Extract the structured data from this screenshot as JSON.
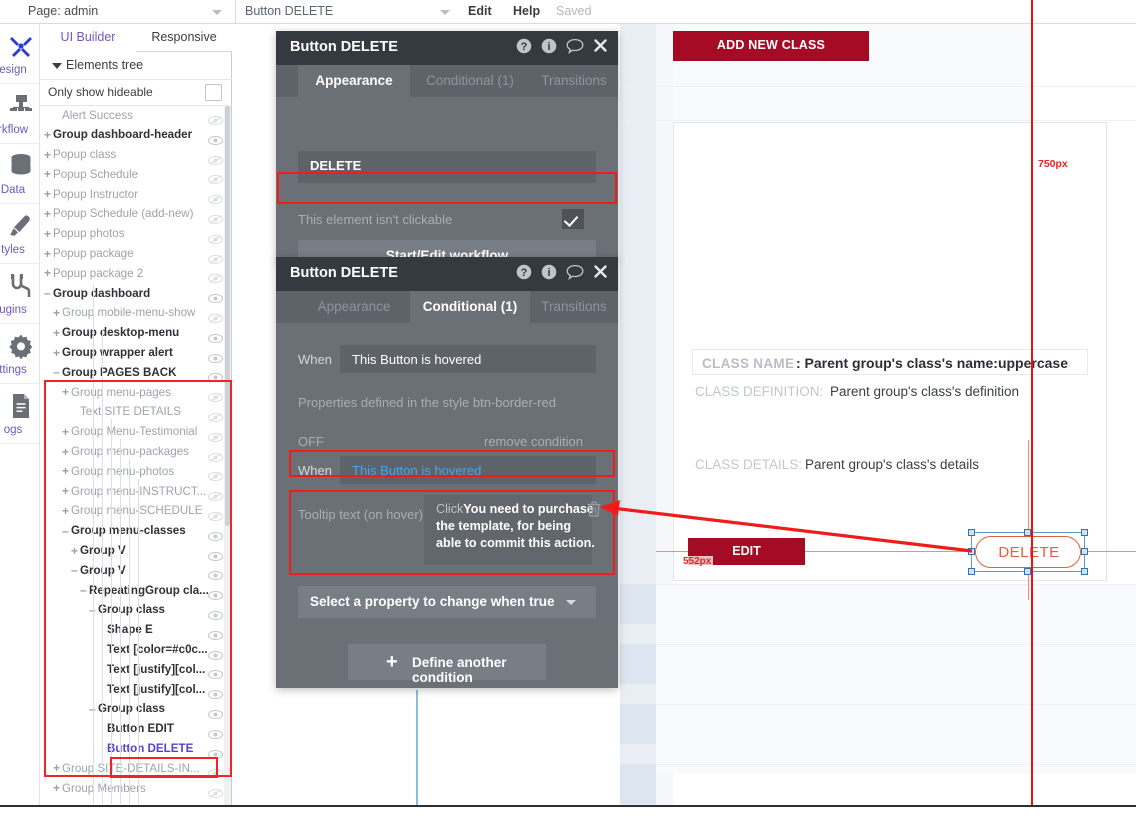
{
  "topbar": {
    "page_label": "Page: admin",
    "element_label": "Button DELETE",
    "edit": "Edit",
    "help": "Help",
    "saved": "Saved"
  },
  "rail": {
    "items": [
      {
        "label": "esign",
        "full": "Design",
        "icon": "design-icon"
      },
      {
        "label": "rkflow",
        "full": "Workflow",
        "icon": "workflow-icon"
      },
      {
        "label": "Data",
        "full": "Data",
        "icon": "data-icon"
      },
      {
        "label": "tyles",
        "full": "Styles",
        "icon": "styles-icon"
      },
      {
        "label": "ugins",
        "full": "Plugins",
        "icon": "plugins-icon"
      },
      {
        "label": "ttings",
        "full": "Settings",
        "icon": "settings-icon"
      },
      {
        "label": "ogs",
        "full": "Logs",
        "icon": "logs-icon"
      }
    ]
  },
  "panel": {
    "tab_ui_builder": "UI Builder",
    "tab_responsive": "Responsive",
    "tree_header": "Elements tree",
    "only_show_hideable": "Only show hideable"
  },
  "tree": {
    "items": [
      {
        "label": "Alert Success",
        "indent": 1,
        "toggle": "",
        "state": "gray",
        "eye": "hidden"
      },
      {
        "label": "Group dashboard-header",
        "indent": 0,
        "toggle": "+",
        "state": "dark",
        "eye": "visible"
      },
      {
        "label": "Popup class",
        "indent": 0,
        "toggle": "+",
        "state": "gray",
        "eye": "hidden"
      },
      {
        "label": "Popup Schedule",
        "indent": 0,
        "toggle": "+",
        "state": "gray",
        "eye": "hidden"
      },
      {
        "label": "Popup Instructor",
        "indent": 0,
        "toggle": "+",
        "state": "gray",
        "eye": "hidden"
      },
      {
        "label": "Popup Schedule (add-new)",
        "indent": 0,
        "toggle": "+",
        "state": "gray",
        "eye": "hidden"
      },
      {
        "label": "Popup photos",
        "indent": 0,
        "toggle": "+",
        "state": "gray",
        "eye": "hidden"
      },
      {
        "label": "Popup package",
        "indent": 0,
        "toggle": "+",
        "state": "gray",
        "eye": "hidden"
      },
      {
        "label": "Popup package 2",
        "indent": 0,
        "toggle": "+",
        "state": "gray",
        "eye": "hidden"
      },
      {
        "label": "Group dashboard",
        "indent": 0,
        "toggle": "–",
        "state": "dark",
        "eye": "visible"
      },
      {
        "label": "Group mobile-menu-show",
        "indent": 1,
        "toggle": "+",
        "state": "gray",
        "eye": "hidden"
      },
      {
        "label": "Group desktop-menu",
        "indent": 1,
        "toggle": "+",
        "state": "dark",
        "eye": "visible"
      },
      {
        "label": "Group wrapper alert",
        "indent": 1,
        "toggle": "+",
        "state": "dark",
        "eye": "visible"
      },
      {
        "label": "Group PAGES BACK",
        "indent": 1,
        "toggle": "–",
        "state": "dark",
        "eye": "visible"
      },
      {
        "label": "Group menu-pages",
        "indent": 2,
        "toggle": "+",
        "state": "gray",
        "eye": "hidden"
      },
      {
        "label": "Text SITE DETAILS",
        "indent": 3,
        "toggle": "",
        "state": "gray",
        "eye": "hidden"
      },
      {
        "label": "Group Menu-Testimonial",
        "indent": 2,
        "toggle": "+",
        "state": "gray",
        "eye": "hidden"
      },
      {
        "label": "Group menu-packages",
        "indent": 2,
        "toggle": "+",
        "state": "gray",
        "eye": "hidden"
      },
      {
        "label": "Group menu-photos",
        "indent": 2,
        "toggle": "+",
        "state": "gray",
        "eye": "hidden"
      },
      {
        "label": "Group menu-INSTRUCT...",
        "indent": 2,
        "toggle": "+",
        "state": "gray",
        "eye": "hidden"
      },
      {
        "label": "Group menu-SCHEDULE",
        "indent": 2,
        "toggle": "+",
        "state": "gray",
        "eye": "hidden"
      },
      {
        "label": "Group menu-classes",
        "indent": 2,
        "toggle": "–",
        "state": "dark",
        "eye": "visible"
      },
      {
        "label": "Group V",
        "indent": 3,
        "toggle": "+",
        "state": "dark",
        "eye": "visible"
      },
      {
        "label": "Group V",
        "indent": 3,
        "toggle": "–",
        "state": "dark",
        "eye": "visible"
      },
      {
        "label": "RepeatingGroup cla...",
        "indent": 4,
        "toggle": "–",
        "state": "dark",
        "eye": "visible"
      },
      {
        "label": "Group class",
        "indent": 5,
        "toggle": "–",
        "state": "dark",
        "eye": "visible"
      },
      {
        "label": "Shape E",
        "indent": 6,
        "toggle": "",
        "state": "dark",
        "eye": "visible"
      },
      {
        "label": "Text [color=#c0c...",
        "indent": 6,
        "toggle": "",
        "state": "dark",
        "eye": "visible"
      },
      {
        "label": "Text [justify][col...",
        "indent": 6,
        "toggle": "",
        "state": "dark",
        "eye": "visible"
      },
      {
        "label": "Text [justify][col...",
        "indent": 6,
        "toggle": "",
        "state": "dark",
        "eye": "visible"
      },
      {
        "label": "Group class",
        "indent": 5,
        "toggle": "–",
        "state": "dark",
        "eye": "visible"
      },
      {
        "label": "Button EDIT",
        "indent": 6,
        "toggle": "",
        "state": "dark",
        "eye": "visible"
      },
      {
        "label": "Button DELETE",
        "indent": 6,
        "toggle": "",
        "state": "selected",
        "eye": "visible"
      },
      {
        "label": "Group SITE-DETAILS-IN...",
        "indent": 1,
        "toggle": "+",
        "state": "gray",
        "eye": "hidden"
      },
      {
        "label": "Group Members",
        "indent": 1,
        "toggle": "+",
        "state": "gray",
        "eye": "hidden"
      }
    ]
  },
  "appearance_panel": {
    "title": "Button DELETE",
    "tabs": [
      {
        "label": "Appearance",
        "active": true
      },
      {
        "label": "Conditional (1)",
        "active": false
      },
      {
        "label": "Transitions",
        "active": false
      }
    ],
    "text_value": "DELETE",
    "clickable_label": "This element isn't clickable",
    "clickable_checked": true,
    "workflow_button": "Start/Edit workflow",
    "icons": [
      "help-icon",
      "info-icon",
      "comment-icon",
      "close-icon"
    ]
  },
  "conditional_panel": {
    "title": "Button DELETE",
    "tabs": [
      {
        "label": "Appearance",
        "active": false
      },
      {
        "label": "Conditional (1)",
        "active": true
      },
      {
        "label": "Transitions",
        "active": false
      }
    ],
    "when_label_1": "When",
    "when_value_1": "This Button is hovered",
    "style_note": "Properties defined in the style btn-border-red",
    "off_label": "OFF",
    "remove_condition": "remove condition",
    "when_label_2": "When",
    "when_value_2": "This Button is hovered",
    "tooltip_field_label": "Tooltip text (on hover)",
    "tooltip_prefix": "Click",
    "tooltip_value": "You need to purchase the template, for being able to commit this action.",
    "delete_icon": "trash-icon",
    "select_property": "Select a property to change when true",
    "define_another": "Define another condition",
    "icons": [
      "help-icon",
      "info-icon",
      "comment-icon",
      "close-icon"
    ]
  },
  "canvas": {
    "add_new_class": "ADD NEW CLASS",
    "guide_750": "750px",
    "guide_552": "552px",
    "class_name_label": "CLASS NAME",
    "class_name_value": ": Parent group's class's name:uppercase",
    "class_definition_label": "CLASS DEFINITION:",
    "class_definition_value": "Parent group's class's definition",
    "class_details_label": "CLASS DETAILS:",
    "class_details_value": "Parent group's class's details",
    "edit_button": "EDIT",
    "delete_button": "DELETE"
  },
  "colors": {
    "brand_red": "#a50b25",
    "annotation_red": "#f01b1b",
    "delete_outline": "#e0603f",
    "panel_bg": "#6b7076",
    "panel_header": "#343a40",
    "accent_purple": "#6d58c6",
    "selection_blue": "#5b9bd5"
  }
}
